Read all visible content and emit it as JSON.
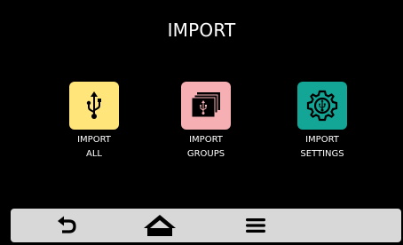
{
  "header": {
    "title": "IMPORT"
  },
  "tiles": [
    {
      "line1": "IMPORT",
      "line2": "ALL",
      "icon": "usb-icon",
      "color": "#ffe57a"
    },
    {
      "line1": "IMPORT",
      "line2": "GROUPS",
      "icon": "usb-stack-icon",
      "color": "#f6b0b4"
    },
    {
      "line1": "IMPORT",
      "line2": "SETTINGS",
      "icon": "gear-settings-icon",
      "color": "#13a595"
    }
  ],
  "bottom_nav": {
    "background": "#d8d8d8",
    "items": [
      {
        "icon": "back-arrow-icon"
      },
      {
        "icon": "home-icon"
      },
      {
        "icon": "menu-icon"
      }
    ]
  }
}
